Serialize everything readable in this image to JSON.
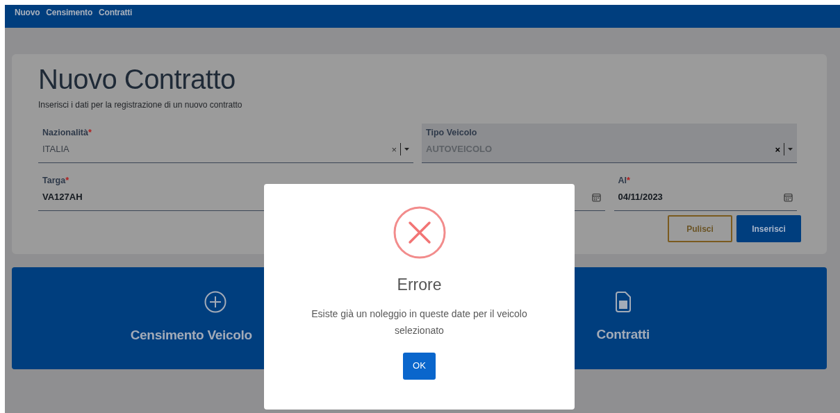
{
  "navbar": {
    "links": [
      "Nuovo",
      "Censimento",
      "Contratti"
    ]
  },
  "form": {
    "title": "Nuovo Contratto",
    "subtitle": "Inserisci i dati per la registrazione di un nuovo contratto",
    "fields": [
      {
        "kind": "select",
        "label": "Nazionalità",
        "asterisk": "*",
        "value": "ITALIA",
        "clear": "×"
      },
      {
        "kind": "select",
        "label": "Tipo Veicolo",
        "value": "AUTOVEICOLO",
        "clear": "×",
        "disabled": true
      },
      {
        "kind": "text",
        "label": "Targa",
        "asterisk": "*",
        "value": "VA127AH"
      },
      {
        "kind": "date"
      },
      {
        "kind": "date",
        "label": "Al",
        "asterisk": "*",
        "value": "04/11/2023"
      }
    ],
    "buttons": [
      {
        "label": "Pulisci",
        "kind": "outline"
      },
      {
        "label": "Inserisci",
        "kind": "primary"
      }
    ]
  },
  "tiles": [
    {
      "label": "Censimento Veicolo",
      "kind": "plus"
    },
    {
      "label": "Contratti",
      "kind": "document"
    }
  ],
  "dialog": {
    "title": "Errore",
    "message": "Esiste già un noleggio in queste date per il veicolo selezionato",
    "button": "OK"
  }
}
